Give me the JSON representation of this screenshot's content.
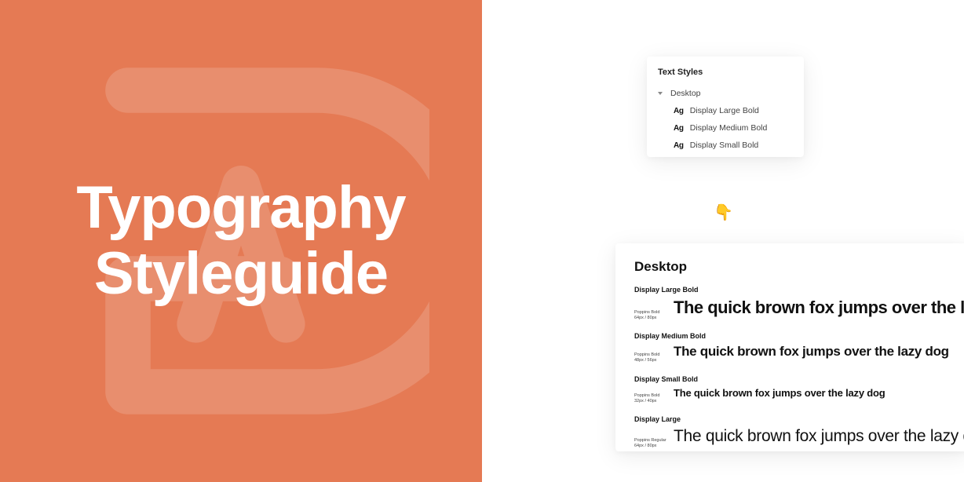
{
  "hero": {
    "title_line1": "Typography",
    "title_line2": "Styleguide"
  },
  "pointer_emoji": "👇",
  "styles_panel": {
    "header": "Text Styles",
    "group_label": "Desktop",
    "items": [
      {
        "icon": "Ag",
        "label": "Display Large Bold"
      },
      {
        "icon": "Ag",
        "label": "Display Medium Bold"
      },
      {
        "icon": "Ag",
        "label": "Display Small Bold"
      }
    ]
  },
  "specimen": {
    "heading": "Desktop",
    "styles": [
      {
        "name": "Display Large Bold",
        "font": "Poppins Bold",
        "size": "64px / 80px",
        "sample": "The quick brown fox jumps over the lazy dog",
        "class": "samp-large-bold"
      },
      {
        "name": "Display Medium Bold",
        "font": "Poppins Bold",
        "size": "48px / 56px",
        "sample": "The quick brown fox jumps over the lazy dog",
        "class": "samp-medium-bold"
      },
      {
        "name": "Display Small Bold",
        "font": "Poppins Bold",
        "size": "32px / 40px",
        "sample": "The quick brown fox jumps over the lazy dog",
        "class": "samp-small-bold"
      },
      {
        "name": "Display Large",
        "font": "Poppins Regular",
        "size": "64px / 80px",
        "sample": "The quick brown fox jumps over the lazy dog",
        "class": "samp-large-reg"
      }
    ]
  }
}
